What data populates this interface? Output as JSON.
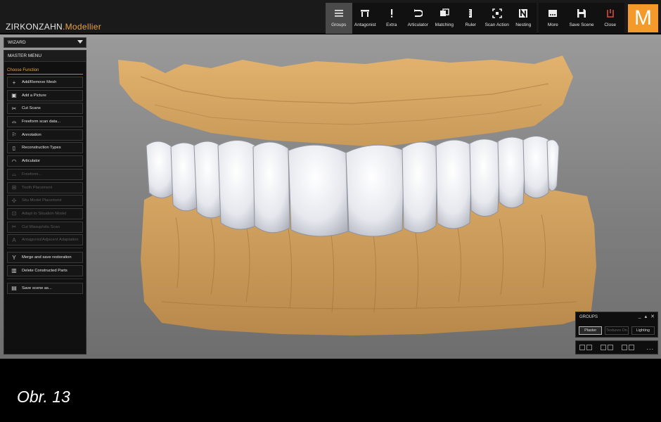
{
  "brand": {
    "part1": "ZIRKONZAHN",
    "part2": ".Modellier"
  },
  "toolbar": {
    "main": [
      {
        "label": "Groups",
        "icon": "list-icon",
        "active": true
      },
      {
        "label": "Antagonist",
        "icon": "antagonist-icon"
      },
      {
        "label": "Extra",
        "icon": "exclamation-icon"
      },
      {
        "label": "Articulator",
        "icon": "articulator-icon"
      },
      {
        "label": "Matching",
        "icon": "matching-icon"
      },
      {
        "label": "Ruler",
        "icon": "ruler-icon"
      },
      {
        "label": "Scan Action",
        "icon": "scan-action-icon"
      },
      {
        "label": "Nesting",
        "icon": "nesting-icon"
      }
    ],
    "right": [
      {
        "label": "More",
        "icon": "more-icon"
      },
      {
        "label": "Save Scene",
        "icon": "save-icon"
      },
      {
        "label": "Close",
        "icon": "power-icon"
      }
    ],
    "logo_letter": "M",
    "accent": "#f39a2a",
    "close_color": "#e04a3a"
  },
  "wizard": {
    "label": "WIZARD"
  },
  "panel": {
    "title": "MASTER MENU",
    "section": "Choose Function",
    "items": [
      {
        "label": "Add/Remove Mesh",
        "icon": "plus-icon",
        "enabled": true
      },
      {
        "label": "Add a Picture",
        "icon": "picture-icon",
        "enabled": true
      },
      {
        "label": "Cut Scans",
        "icon": "scissors-icon",
        "enabled": true
      },
      {
        "label": "Freeform scan data...",
        "icon": "freeform-scan-icon",
        "enabled": true
      },
      {
        "label": "Annotation",
        "icon": "annotation-icon",
        "enabled": true
      },
      {
        "label": "Reconstruction Types",
        "icon": "reconstruction-icon",
        "enabled": true
      },
      {
        "label": "Articulator",
        "icon": "articulator-icon",
        "enabled": true
      },
      {
        "label": "Freeform...",
        "icon": "freeform-icon",
        "enabled": false
      },
      {
        "label": "Tooth Placement",
        "icon": "tooth-placement-icon",
        "enabled": false
      },
      {
        "label": "Situ Model Placement",
        "icon": "situ-placement-icon",
        "enabled": false
      },
      {
        "label": "Adapt to Situation Model",
        "icon": "adapt-icon",
        "enabled": false
      },
      {
        "label": "Cut Waxup/situ Scan",
        "icon": "scissors-icon",
        "enabled": false
      },
      {
        "label": "Antagonist/Adjacent Adaptation",
        "icon": "letter-a-icon",
        "enabled": false
      }
    ],
    "items2": [
      {
        "label": "Merge and save restoration",
        "icon": "merge-icon",
        "enabled": true
      },
      {
        "label": "Delete Constructed Parts",
        "icon": "trash-icon",
        "enabled": true
      }
    ],
    "items3": [
      {
        "label": "Save scene as...",
        "icon": "save-scene-icon",
        "enabled": true
      }
    ]
  },
  "groups": {
    "title": "GROUPS",
    "buttons": [
      {
        "label": "Plaster",
        "state": "on"
      },
      {
        "label": "Textures On",
        "state": "dim"
      },
      {
        "label": "Lighting",
        "state": "normal"
      }
    ],
    "more": "..."
  },
  "caption": "Obr. 13"
}
